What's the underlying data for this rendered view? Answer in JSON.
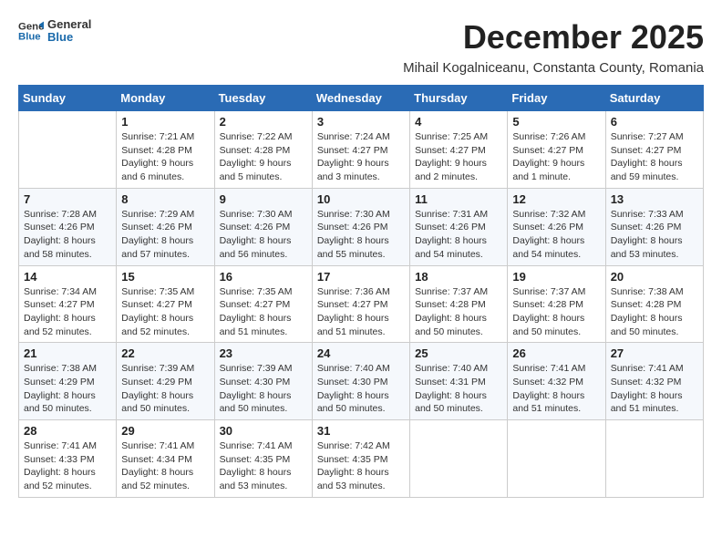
{
  "logo": {
    "line1": "General",
    "line2": "Blue"
  },
  "title": "December 2025",
  "subtitle": "Mihail Kogalniceanu, Constanta County, Romania",
  "weekdays": [
    "Sunday",
    "Monday",
    "Tuesday",
    "Wednesday",
    "Thursday",
    "Friday",
    "Saturday"
  ],
  "weeks": [
    [
      {
        "day": "",
        "info": ""
      },
      {
        "day": "1",
        "info": "Sunrise: 7:21 AM\nSunset: 4:28 PM\nDaylight: 9 hours\nand 6 minutes."
      },
      {
        "day": "2",
        "info": "Sunrise: 7:22 AM\nSunset: 4:28 PM\nDaylight: 9 hours\nand 5 minutes."
      },
      {
        "day": "3",
        "info": "Sunrise: 7:24 AM\nSunset: 4:27 PM\nDaylight: 9 hours\nand 3 minutes."
      },
      {
        "day": "4",
        "info": "Sunrise: 7:25 AM\nSunset: 4:27 PM\nDaylight: 9 hours\nand 2 minutes."
      },
      {
        "day": "5",
        "info": "Sunrise: 7:26 AM\nSunset: 4:27 PM\nDaylight: 9 hours\nand 1 minute."
      },
      {
        "day": "6",
        "info": "Sunrise: 7:27 AM\nSunset: 4:27 PM\nDaylight: 8 hours\nand 59 minutes."
      }
    ],
    [
      {
        "day": "7",
        "info": "Sunrise: 7:28 AM\nSunset: 4:26 PM\nDaylight: 8 hours\nand 58 minutes."
      },
      {
        "day": "8",
        "info": "Sunrise: 7:29 AM\nSunset: 4:26 PM\nDaylight: 8 hours\nand 57 minutes."
      },
      {
        "day": "9",
        "info": "Sunrise: 7:30 AM\nSunset: 4:26 PM\nDaylight: 8 hours\nand 56 minutes."
      },
      {
        "day": "10",
        "info": "Sunrise: 7:30 AM\nSunset: 4:26 PM\nDaylight: 8 hours\nand 55 minutes."
      },
      {
        "day": "11",
        "info": "Sunrise: 7:31 AM\nSunset: 4:26 PM\nDaylight: 8 hours\nand 54 minutes."
      },
      {
        "day": "12",
        "info": "Sunrise: 7:32 AM\nSunset: 4:26 PM\nDaylight: 8 hours\nand 54 minutes."
      },
      {
        "day": "13",
        "info": "Sunrise: 7:33 AM\nSunset: 4:26 PM\nDaylight: 8 hours\nand 53 minutes."
      }
    ],
    [
      {
        "day": "14",
        "info": "Sunrise: 7:34 AM\nSunset: 4:27 PM\nDaylight: 8 hours\nand 52 minutes."
      },
      {
        "day": "15",
        "info": "Sunrise: 7:35 AM\nSunset: 4:27 PM\nDaylight: 8 hours\nand 52 minutes."
      },
      {
        "day": "16",
        "info": "Sunrise: 7:35 AM\nSunset: 4:27 PM\nDaylight: 8 hours\nand 51 minutes."
      },
      {
        "day": "17",
        "info": "Sunrise: 7:36 AM\nSunset: 4:27 PM\nDaylight: 8 hours\nand 51 minutes."
      },
      {
        "day": "18",
        "info": "Sunrise: 7:37 AM\nSunset: 4:28 PM\nDaylight: 8 hours\nand 50 minutes."
      },
      {
        "day": "19",
        "info": "Sunrise: 7:37 AM\nSunset: 4:28 PM\nDaylight: 8 hours\nand 50 minutes."
      },
      {
        "day": "20",
        "info": "Sunrise: 7:38 AM\nSunset: 4:28 PM\nDaylight: 8 hours\nand 50 minutes."
      }
    ],
    [
      {
        "day": "21",
        "info": "Sunrise: 7:38 AM\nSunset: 4:29 PM\nDaylight: 8 hours\nand 50 minutes."
      },
      {
        "day": "22",
        "info": "Sunrise: 7:39 AM\nSunset: 4:29 PM\nDaylight: 8 hours\nand 50 minutes."
      },
      {
        "day": "23",
        "info": "Sunrise: 7:39 AM\nSunset: 4:30 PM\nDaylight: 8 hours\nand 50 minutes."
      },
      {
        "day": "24",
        "info": "Sunrise: 7:40 AM\nSunset: 4:30 PM\nDaylight: 8 hours\nand 50 minutes."
      },
      {
        "day": "25",
        "info": "Sunrise: 7:40 AM\nSunset: 4:31 PM\nDaylight: 8 hours\nand 50 minutes."
      },
      {
        "day": "26",
        "info": "Sunrise: 7:41 AM\nSunset: 4:32 PM\nDaylight: 8 hours\nand 51 minutes."
      },
      {
        "day": "27",
        "info": "Sunrise: 7:41 AM\nSunset: 4:32 PM\nDaylight: 8 hours\nand 51 minutes."
      }
    ],
    [
      {
        "day": "28",
        "info": "Sunrise: 7:41 AM\nSunset: 4:33 PM\nDaylight: 8 hours\nand 52 minutes."
      },
      {
        "day": "29",
        "info": "Sunrise: 7:41 AM\nSunset: 4:34 PM\nDaylight: 8 hours\nand 52 minutes."
      },
      {
        "day": "30",
        "info": "Sunrise: 7:41 AM\nSunset: 4:35 PM\nDaylight: 8 hours\nand 53 minutes."
      },
      {
        "day": "31",
        "info": "Sunrise: 7:42 AM\nSunset: 4:35 PM\nDaylight: 8 hours\nand 53 minutes."
      },
      {
        "day": "",
        "info": ""
      },
      {
        "day": "",
        "info": ""
      },
      {
        "day": "",
        "info": ""
      }
    ]
  ]
}
